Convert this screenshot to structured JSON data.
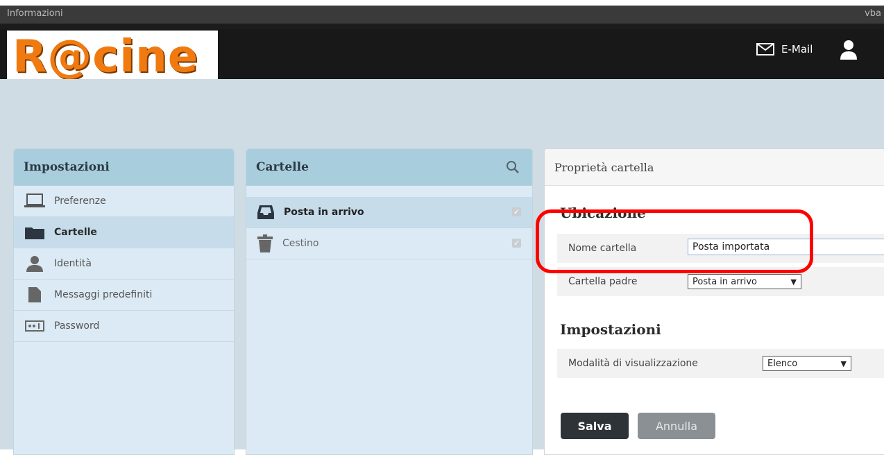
{
  "topbar": {
    "left_text": "Informazioni",
    "right_text": "vba"
  },
  "header": {
    "logo_text": "R@cine",
    "mail_label": "E-Mail"
  },
  "settings_panel": {
    "title": "Impostazioni",
    "items": [
      {
        "label": "Preferenze",
        "icon": "monitor-icon"
      },
      {
        "label": "Cartelle",
        "icon": "folder-icon",
        "selected": true
      },
      {
        "label": "Identità",
        "icon": "user-icon"
      },
      {
        "label": "Messaggi predefiniti",
        "icon": "document-icon"
      },
      {
        "label": "Password",
        "icon": "password-icon"
      }
    ]
  },
  "folders_panel": {
    "title": "Cartelle",
    "items": [
      {
        "label": "Posta in arrivo",
        "icon": "inbox-icon",
        "selected": true
      },
      {
        "label": "Cestino",
        "icon": "trash-icon"
      }
    ]
  },
  "properties_panel": {
    "title": "Proprietà cartella",
    "location_heading": "Ubicazione",
    "folder_name_label": "Nome cartella",
    "folder_name_value": "Posta importata",
    "parent_label": "Cartella padre",
    "parent_value": "Posta in arrivo",
    "settings_heading": "Impostazioni",
    "view_mode_label": "Modalità di visualizzazione",
    "view_mode_value": "Elenco",
    "save_label": "Salva",
    "cancel_label": "Annulla"
  },
  "colors": {
    "highlight": "#ff0000",
    "logo": "#f07a10"
  }
}
